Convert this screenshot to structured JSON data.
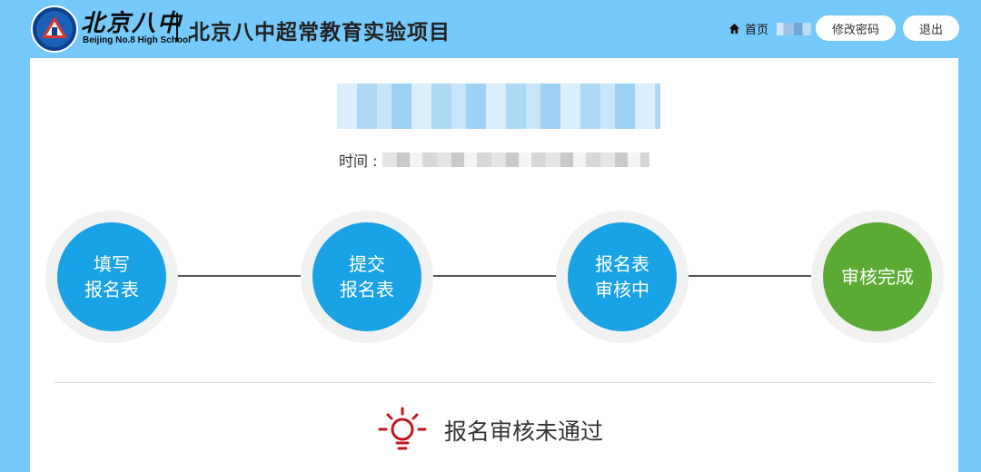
{
  "header": {
    "logo_cn": "北京八中",
    "logo_en": "Beijing No.8 High School",
    "site_title": "北京八中超常教育实验项目",
    "home_label": "首页",
    "change_password_label": "修改密码",
    "logout_label": "退出"
  },
  "main": {
    "time_label": "时间 :",
    "steps": [
      {
        "label": "填写\n报名表"
      },
      {
        "label": "提交\n报名表"
      },
      {
        "label": "报名表\n审核中"
      },
      {
        "label": "审核完成"
      }
    ],
    "status_text": "报名审核未通过"
  },
  "colors": {
    "header_bg": "#76c9fb",
    "step_blue": "#1aa2e6",
    "step_green": "#5aaa34",
    "alert_red": "#c0181e"
  },
  "icons": [
    "home-icon",
    "lightbulb-icon",
    "school-logo"
  ]
}
